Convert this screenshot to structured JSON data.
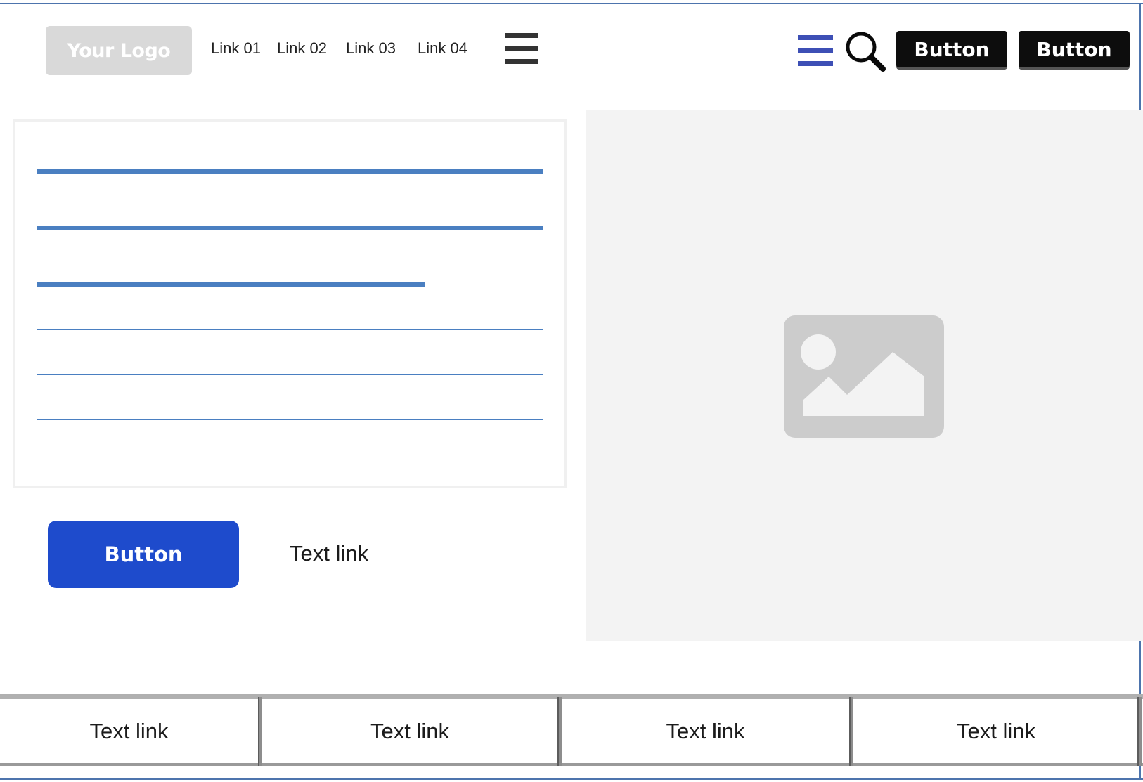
{
  "header": {
    "logo_text": "Your Logo",
    "nav_links": [
      "Link 01",
      "Link 02",
      "Link 03",
      "Link 04"
    ],
    "buttons": [
      "Button",
      "Button"
    ]
  },
  "main": {
    "primary_button": "Button",
    "text_link": "Text link"
  },
  "footer": {
    "links": [
      "Text link",
      "Text link",
      "Text link",
      "Text link"
    ]
  },
  "colors": {
    "accent_blue": "#1e4bcc",
    "line_blue": "#4a7fc1",
    "menu_blue": "#3d4fb5",
    "placeholder_gray": "#d9d9d9"
  },
  "icons": {
    "menu": "hamburger-icon",
    "menu_alt": "hamburger-blue-icon",
    "search": "search-icon",
    "image": "image-placeholder-icon"
  }
}
